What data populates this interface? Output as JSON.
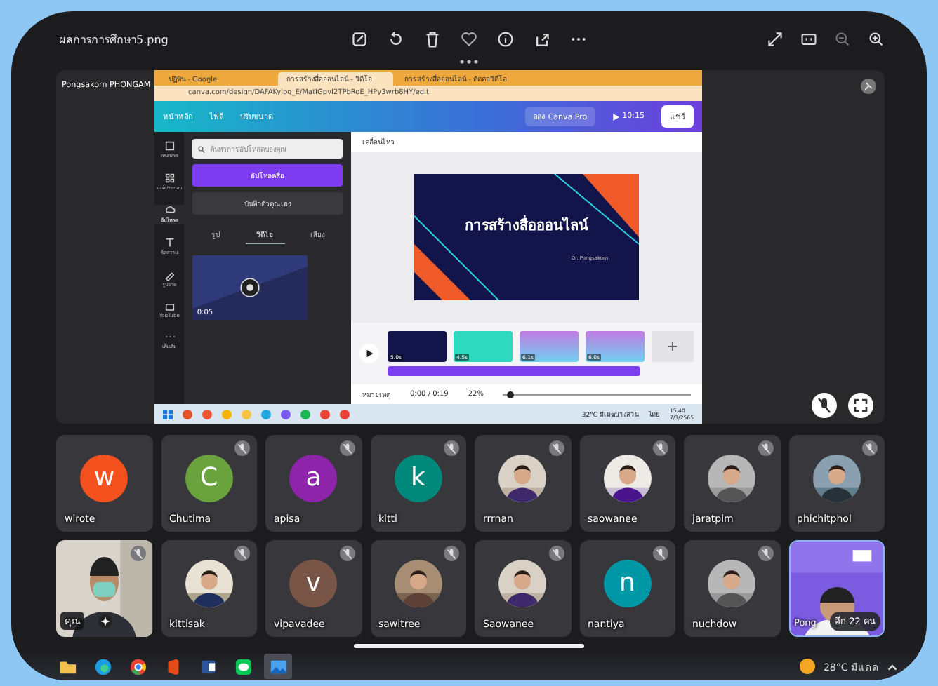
{
  "viewer": {
    "file_name": "ผลการการศึกษา5.png"
  },
  "meeting": {
    "presenter_name": "Pongsakorn PHONGAM",
    "screen": {
      "browser_tabs": [
        {
          "label": "ปฏิทิน - Google",
          "selected": false
        },
        {
          "label": "การสร้างสื่อออนไลน์ - วิดีโอ",
          "selected": true
        },
        {
          "label": "การสร้างสื่อออนไลน์ - ตัดต่อวิดีโอ",
          "selected": false
        }
      ],
      "url": "canva.com/design/DAFAKyjpg_E/MatIGpvI2TPbRoE_HPy3wrb8HY/edit",
      "header": {
        "back": "หน้าหลัก",
        "file": "ไฟล์",
        "resize": "ปรับขนาด",
        "pro": "ลอง Canva Pro",
        "play_time": "10:15",
        "share": "แชร์"
      },
      "sidebar": [
        {
          "label": "เทมเพลต",
          "selected": false
        },
        {
          "label": "องค์ประกอบ",
          "selected": false
        },
        {
          "label": "อัปโหลด",
          "selected": true
        },
        {
          "label": "ข้อความ",
          "selected": false
        },
        {
          "label": "รูปวาด",
          "selected": false
        },
        {
          "label": "YouTube",
          "selected": false
        },
        {
          "label": "เพิ่มเติม",
          "selected": false
        }
      ],
      "panel": {
        "search": {
          "placeholder": "ค้นหาการอัปโหลดของคุณ"
        },
        "upload_button": "อัปโหลดสื่อ",
        "record_button": "บันทึกตัวคุณเอง",
        "tabs": [
          {
            "label": "รูป",
            "selected": false
          },
          {
            "label": "วิดีโอ",
            "selected": true
          },
          {
            "label": "เสียง",
            "selected": false
          }
        ],
        "video": {
          "duration": "0:05"
        }
      },
      "toolbar": {
        "animate": "เคลื่อนไหว"
      },
      "slide": {
        "title": "การสร้างสื่อออนไลน์",
        "caption": "Dr. Pongsakorn"
      },
      "timeline": [
        {
          "duration": "5.0s",
          "kind": "title"
        },
        {
          "duration": "4.5s",
          "kind": "teal"
        },
        {
          "duration": "6.1s",
          "kind": "pink"
        },
        {
          "duration": "6.0s",
          "kind": "pink"
        }
      ],
      "footer": {
        "notes": "หมายเหตุ",
        "time": "0:00 / 0:19",
        "zoom": "22%",
        "zoom_slider": {
          "level": 0.02
        }
      },
      "win_taskbar": {
        "temperature": "32°C",
        "weather": "มีเมฆบางส่วน",
        "language": "ไทย",
        "time": "15:40",
        "date": "7/3/2565"
      }
    }
  },
  "participants": [
    {
      "name": "wirote",
      "kind": "letter",
      "letter": "w",
      "color": "#f4511e",
      "muted": false
    },
    {
      "name": "Chutima",
      "kind": "letter",
      "letter": "C",
      "color": "#6aa33e",
      "muted": true
    },
    {
      "name": "apisa",
      "kind": "letter",
      "letter": "a",
      "color": "#8e24aa",
      "muted": true
    },
    {
      "name": "kitti",
      "kind": "letter",
      "letter": "k",
      "color": "#00897b",
      "muted": true
    },
    {
      "name": "rrrnan",
      "muted": true
    },
    {
      "name": "saowanee",
      "muted": true
    },
    {
      "name": "jaratpim",
      "muted": true
    },
    {
      "name": "phichitphol",
      "muted": true
    },
    {
      "name": "คุณ",
      "kind": "video",
      "muted": true
    },
    {
      "name": "kittisak",
      "muted": true
    },
    {
      "name": "vipavadee",
      "kind": "letter",
      "letter": "v",
      "color": "#795548",
      "muted": true
    },
    {
      "name": "sawitree",
      "muted": true
    },
    {
      "name": "Saowanee",
      "muted": true
    },
    {
      "name": "nantiya",
      "kind": "letter",
      "letter": "n",
      "color": "#0097a7",
      "muted": true
    },
    {
      "name": "nuchdow",
      "muted": true
    },
    {
      "name": "Pong",
      "kind": "presenting",
      "muted": false,
      "more": "อีก 22 คน"
    }
  ],
  "taskbar": {
    "apps": [
      {
        "kind": "folder",
        "selected": false
      },
      {
        "kind": "edge",
        "selected": false
      },
      {
        "kind": "chrome",
        "selected": false
      },
      {
        "kind": "office",
        "selected": false
      },
      {
        "kind": "word",
        "selected": false
      },
      {
        "kind": "line",
        "selected": false
      },
      {
        "kind": "photos",
        "selected": true
      }
    ],
    "temperature": "28°C",
    "weather": "มีแดด"
  }
}
